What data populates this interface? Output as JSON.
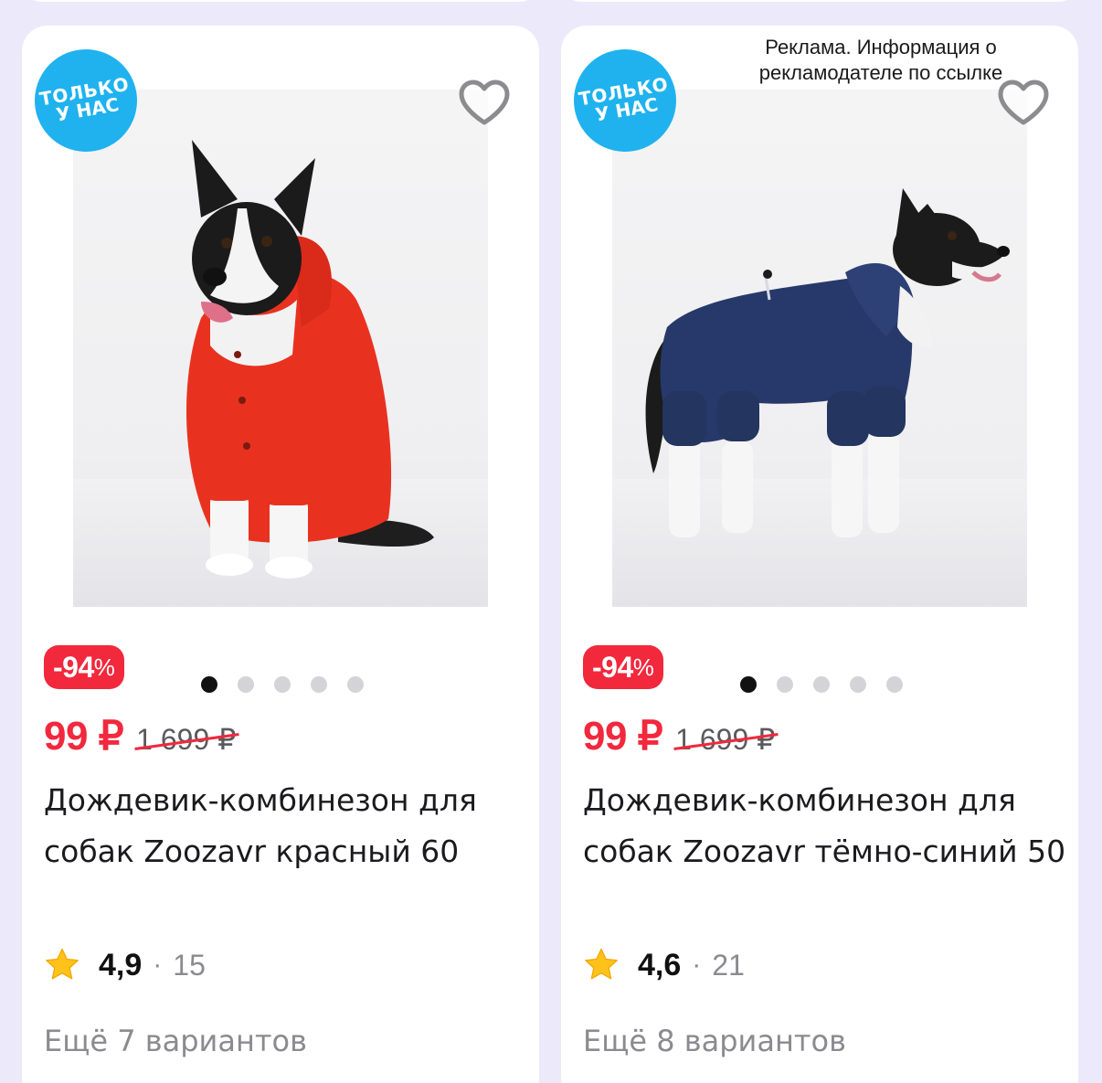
{
  "badges": {
    "only_us_line1": "ТОЛЬКО",
    "only_us_line2": "У НАС"
  },
  "ad_notice": "Реклама. Информация о рекламодателе по ссылке",
  "colors": {
    "accent_red": "#f2283d",
    "badge_blue": "#1fb2ee",
    "star_yellow": "#ffc21a"
  },
  "products": [
    {
      "discount_number": "-94",
      "discount_sign": "%",
      "price_now": "99 ₽",
      "price_old": "1 699 ₽",
      "title": "Дождевик-комбинезон для собак Zoozavr красный 60",
      "rating": "4,9",
      "rating_separator": "·",
      "reviews": "15",
      "variants": "Ещё 7 вариантов",
      "image_dots": 5,
      "active_dot": 1,
      "icons": {
        "favorite": "heart-outline-icon",
        "rating": "star-icon"
      }
    },
    {
      "discount_number": "-94",
      "discount_sign": "%",
      "price_now": "99 ₽",
      "price_old": "1 699 ₽",
      "title": "Дождевик-комбинезон для собак Zoozavr тёмно-синий 50",
      "rating": "4,6",
      "rating_separator": "·",
      "reviews": "21",
      "variants": "Ещё 8 вариантов",
      "image_dots": 5,
      "active_dot": 1,
      "icons": {
        "favorite": "heart-outline-icon",
        "rating": "star-icon"
      }
    }
  ]
}
